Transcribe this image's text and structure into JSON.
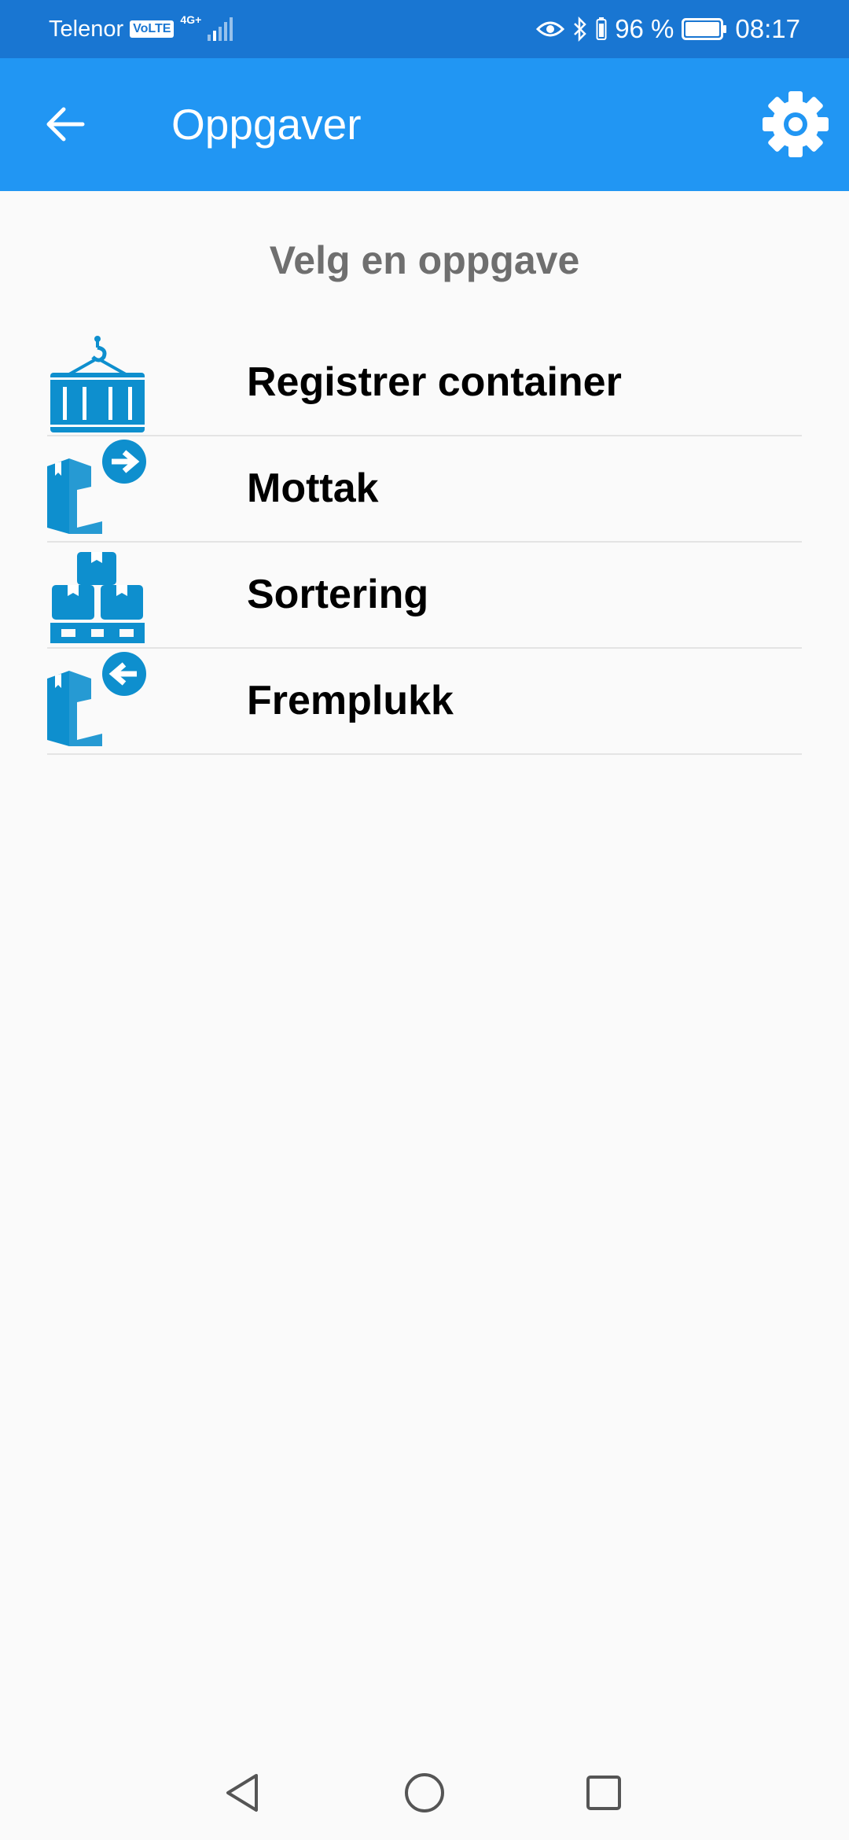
{
  "status_bar": {
    "carrier": "Telenor",
    "volte": "VoLTE",
    "network": "4G+",
    "battery": "96 %",
    "time": "08:17",
    "icons": [
      "signal-icon",
      "eye-icon",
      "bluetooth-icon",
      "battery-icon"
    ]
  },
  "app_bar": {
    "title": "Oppgaver",
    "back_icon": "arrow-back-icon",
    "settings_icon": "gear-icon",
    "color": "#2196f3"
  },
  "main": {
    "heading": "Velg en oppgave",
    "tasks": [
      {
        "label": "Registrer container",
        "icon": "container-crane-icon"
      },
      {
        "label": "Mottak",
        "icon": "box-arrow-in-icon"
      },
      {
        "label": "Sortering",
        "icon": "pallet-boxes-icon"
      },
      {
        "label": "Fremplukk",
        "icon": "box-arrow-out-icon"
      }
    ],
    "icon_color": "#0e8fce"
  },
  "nav_bar": {
    "back": "nav-back-icon",
    "home": "nav-home-icon",
    "recents": "nav-recents-icon"
  }
}
